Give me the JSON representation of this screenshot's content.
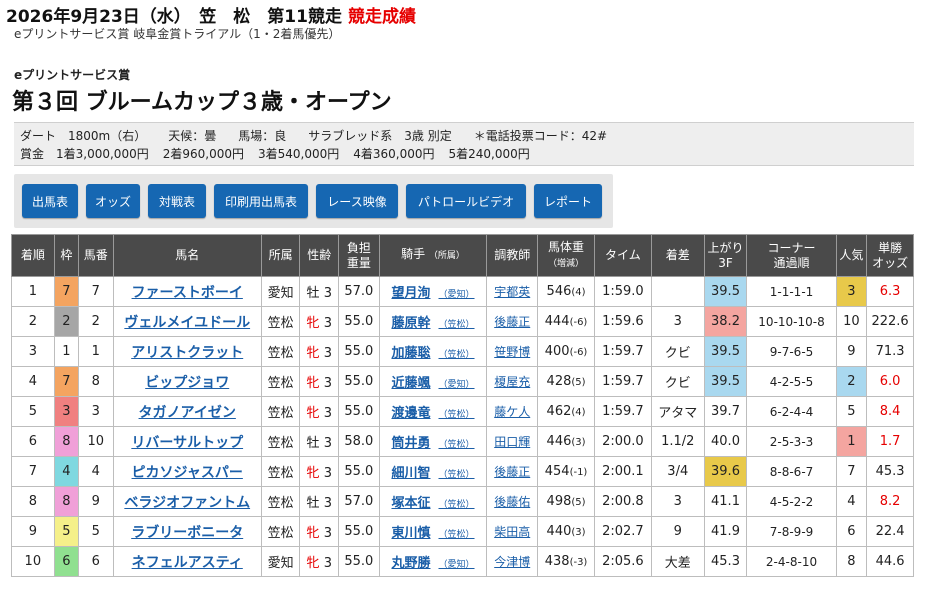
{
  "header": {
    "date_venue": "2026年9月23日（水）　笠　松　第11競走",
    "result_label": "競走成績",
    "sub": "eプリントサービス賞 岐阜金賞トライアル（1・2着馬優先）"
  },
  "race": {
    "sponsor": "eプリントサービス賞",
    "title": "第３回 ブルームカップ３歳・オープン"
  },
  "info": {
    "course": "ダート　1800m（右）",
    "weather": "天候：曇",
    "track": "馬場：良",
    "breed": "サラブレッド系　3歳 別定",
    "phone_code": "＊電話投票コード：42#",
    "prizes": [
      "賞金　1着3,000,000円",
      "2着960,000円",
      "3着540,000円",
      "4着360,000円",
      "5着240,000円"
    ]
  },
  "buttons": [
    "出馬表",
    "オッズ",
    "対戦表",
    "印刷用出馬表",
    "レース映像",
    "パトロールビデオ",
    "レポート"
  ],
  "columns": {
    "rank": "着順",
    "frame": "枠",
    "num": "馬番",
    "horse": "馬名",
    "affil": "所属",
    "sexage": "性齢",
    "load1": "負担",
    "load2": "重量",
    "jockey": "騎手",
    "jockey_sub": "（所属）",
    "trainer": "調教師",
    "bw1": "馬体重",
    "bw2": "（増減）",
    "time": "タイム",
    "margin": "着差",
    "last1": "上がり",
    "last2": "3F",
    "corner1": "コーナー",
    "corner2": "通過順",
    "pop": "人気",
    "odds1": "単勝",
    "odds2": "オッズ"
  },
  "colors": {
    "header_bg": "#4a4a4a",
    "link": "#1a5ea8",
    "accent_red": "#e60000",
    "last3f_top": "#e8c94a",
    "last3f_good": "#a9d8ef",
    "pop1": "#f4a5a0",
    "pop2": "#a9d8ef",
    "pop3": "#e8c94a"
  },
  "rows": [
    {
      "rank": "1",
      "frame": "7",
      "frame_color": "#f4a460",
      "num": "7",
      "horse": "ファーストボーイ",
      "affil": "愛知",
      "sex": "牡",
      "age": "3",
      "mare": false,
      "load": "57.0",
      "jockey": "望月洵",
      "jbelong": "（愛知）",
      "trainer": "宇都英",
      "bw": "546",
      "bwd": "(4)",
      "time": "1:59.0",
      "margin": "",
      "last3f": "39.5",
      "l3_color": "#a9d8ef",
      "corner": "1-1-1-1",
      "pop": "3",
      "pop_color": "#e8c94a",
      "odds": "6.3",
      "odds_red": true
    },
    {
      "rank": "2",
      "frame": "2",
      "frame_color": "#a6a6a6",
      "num": "2",
      "horse": "ヴェルメイユドール",
      "affil": "笠松",
      "sex": "牝",
      "age": "3",
      "mare": true,
      "load": "55.0",
      "jockey": "藤原幹",
      "jbelong": "（笠松）",
      "trainer": "後藤正",
      "bw": "444",
      "bwd": "(-6)",
      "time": "1:59.6",
      "margin": "3",
      "last3f": "38.2",
      "l3_color": "#f4a5a0",
      "corner": "10-10-10-8",
      "pop": "10",
      "pop_color": "",
      "odds": "222.6",
      "odds_red": false
    },
    {
      "rank": "3",
      "frame": "1",
      "frame_color": "#ffffff",
      "num": "1",
      "horse": "アリストクラット",
      "affil": "笠松",
      "sex": "牝",
      "age": "3",
      "mare": true,
      "load": "55.0",
      "jockey": "加藤聡",
      "jbelong": "（笠松）",
      "trainer": "笹野博",
      "bw": "400",
      "bwd": "(-6)",
      "time": "1:59.7",
      "margin": "クビ",
      "last3f": "39.5",
      "l3_color": "#a9d8ef",
      "corner": "9-7-6-5",
      "pop": "9",
      "pop_color": "",
      "odds": "71.3",
      "odds_red": false
    },
    {
      "rank": "4",
      "frame": "7",
      "frame_color": "#f4a460",
      "num": "8",
      "horse": "ビップジョワ",
      "affil": "笠松",
      "sex": "牝",
      "age": "3",
      "mare": true,
      "load": "55.0",
      "jockey": "近藤颯",
      "jbelong": "（愛知）",
      "trainer": "榎屋充",
      "bw": "428",
      "bwd": "(5)",
      "time": "1:59.7",
      "margin": "クビ",
      "last3f": "39.5",
      "l3_color": "#a9d8ef",
      "corner": "4-2-5-5",
      "pop": "2",
      "pop_color": "#a9d8ef",
      "odds": "6.0",
      "odds_red": true
    },
    {
      "rank": "5",
      "frame": "3",
      "frame_color": "#f08080",
      "num": "3",
      "horse": "タガノアイゼン",
      "affil": "笠松",
      "sex": "牝",
      "age": "3",
      "mare": true,
      "load": "55.0",
      "jockey": "渡邊竜",
      "jbelong": "（笠松）",
      "trainer": "藤ケ人",
      "bw": "462",
      "bwd": "(4)",
      "time": "1:59.7",
      "margin": "アタマ",
      "last3f": "39.7",
      "l3_color": "",
      "corner": "6-2-4-4",
      "pop": "5",
      "pop_color": "",
      "odds": "8.4",
      "odds_red": true
    },
    {
      "rank": "6",
      "frame": "8",
      "frame_color": "#f0a0d8",
      "num": "10",
      "horse": "リバーサルトップ",
      "affil": "笠松",
      "sex": "牡",
      "age": "3",
      "mare": false,
      "load": "58.0",
      "jockey": "筒井勇",
      "jbelong": "（笠松）",
      "trainer": "田口輝",
      "bw": "446",
      "bwd": "(3)",
      "time": "2:00.0",
      "margin": "1.1/2",
      "last3f": "40.0",
      "l3_color": "",
      "corner": "2-5-3-3",
      "pop": "1",
      "pop_color": "#f4a5a0",
      "odds": "1.7",
      "odds_red": true
    },
    {
      "rank": "7",
      "frame": "4",
      "frame_color": "#7fd8e0",
      "num": "4",
      "horse": "ピカソジャスパー",
      "affil": "笠松",
      "sex": "牝",
      "age": "3",
      "mare": true,
      "load": "55.0",
      "jockey": "細川智",
      "jbelong": "（笠松）",
      "trainer": "後藤正",
      "bw": "454",
      "bwd": "(-1)",
      "time": "2:00.1",
      "margin": "3/4",
      "last3f": "39.6",
      "l3_color": "#e8c94a",
      "corner": "8-8-6-7",
      "pop": "7",
      "pop_color": "",
      "odds": "45.3",
      "odds_red": false
    },
    {
      "rank": "8",
      "frame": "8",
      "frame_color": "#f0a0d8",
      "num": "9",
      "horse": "ベラジオファントム",
      "affil": "笠松",
      "sex": "牡",
      "age": "3",
      "mare": false,
      "load": "57.0",
      "jockey": "塚本征",
      "jbelong": "（笠松）",
      "trainer": "後藤佑",
      "bw": "498",
      "bwd": "(5)",
      "time": "2:00.8",
      "margin": "3",
      "last3f": "41.1",
      "l3_color": "",
      "corner": "4-5-2-2",
      "pop": "4",
      "pop_color": "",
      "odds": "8.2",
      "odds_red": true
    },
    {
      "rank": "9",
      "frame": "5",
      "frame_color": "#f5f08a",
      "num": "5",
      "horse": "ラブリーボニータ",
      "affil": "笠松",
      "sex": "牝",
      "age": "3",
      "mare": true,
      "load": "55.0",
      "jockey": "東川慎",
      "jbelong": "（笠松）",
      "trainer": "柴田高",
      "bw": "440",
      "bwd": "(3)",
      "time": "2:02.7",
      "margin": "9",
      "last3f": "41.9",
      "l3_color": "",
      "corner": "7-8-9-9",
      "pop": "6",
      "pop_color": "",
      "odds": "22.4",
      "odds_red": false
    },
    {
      "rank": "10",
      "frame": "6",
      "frame_color": "#90e090",
      "num": "6",
      "horse": "ネフェルアスティ",
      "affil": "愛知",
      "sex": "牝",
      "age": "3",
      "mare": true,
      "load": "55.0",
      "jockey": "丸野勝",
      "jbelong": "（愛知）",
      "trainer": "今津博",
      "bw": "438",
      "bwd": "(-3)",
      "time": "2:05.6",
      "margin": "大差",
      "last3f": "45.3",
      "l3_color": "",
      "corner": "2-4-8-10",
      "pop": "8",
      "pop_color": "",
      "odds": "44.6",
      "odds_red": false
    }
  ]
}
